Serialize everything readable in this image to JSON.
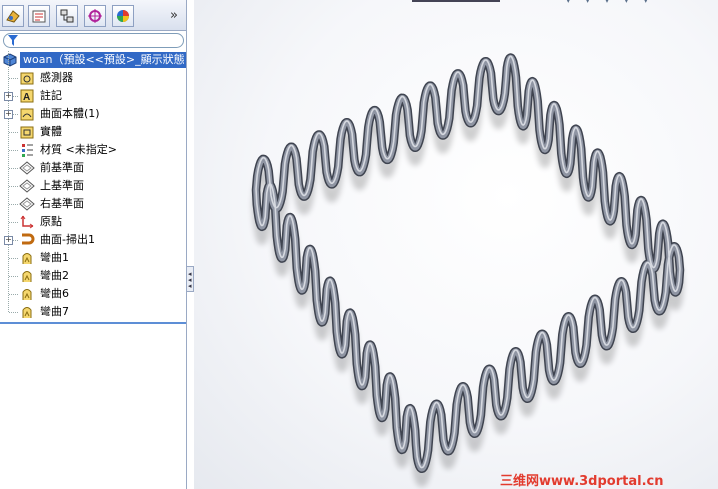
{
  "toolbar": {
    "tabs": [
      {
        "name": "feature-manager-tab-icon"
      },
      {
        "name": "property-manager-tab-icon"
      },
      {
        "name": "configuration-manager-tab-icon"
      },
      {
        "name": "dimxpert-tab-icon"
      },
      {
        "name": "display-manager-tab-icon"
      }
    ],
    "more_label": "»"
  },
  "filter": {
    "icon": "filter-icon"
  },
  "tree": {
    "root": {
      "label": "woan（預設<<預設>_顯示狀態",
      "icon": "part-icon"
    },
    "items": [
      {
        "label": "感測器",
        "icon": "sensor-icon",
        "expandable": false
      },
      {
        "label": "註記",
        "icon": "annotation-icon",
        "expandable": true
      },
      {
        "label": "曲面本體(1)",
        "icon": "surface-bodies-icon",
        "expandable": true
      },
      {
        "label": "實體",
        "icon": "solid-bodies-icon",
        "expandable": false
      },
      {
        "label": "材質 <未指定>",
        "icon": "material-icon",
        "expandable": false
      },
      {
        "label": "前基準面",
        "icon": "plane-icon",
        "expandable": false
      },
      {
        "label": "上基準面",
        "icon": "plane-icon",
        "expandable": false
      },
      {
        "label": "右基準面",
        "icon": "plane-icon",
        "expandable": false
      },
      {
        "label": "原點",
        "icon": "origin-icon",
        "expandable": false
      },
      {
        "label": "曲面-掃出1",
        "icon": "surface-sweep-icon",
        "expandable": true
      },
      {
        "label": "彎曲1",
        "icon": "flex-icon",
        "expandable": false
      },
      {
        "label": "彎曲2",
        "icon": "flex-icon",
        "expandable": false
      },
      {
        "label": "彎曲6",
        "icon": "flex-icon",
        "expandable": false
      },
      {
        "label": "彎曲7",
        "icon": "flex-icon",
        "expandable": false
      }
    ]
  },
  "viewport": {
    "model": "wavy-wire-spring-frame",
    "watermark": "三维网www.3dportal.cn"
  },
  "colors": {
    "selection": "#3169c6",
    "wire": "#8f95a3",
    "watermark": "#e23b2e"
  }
}
